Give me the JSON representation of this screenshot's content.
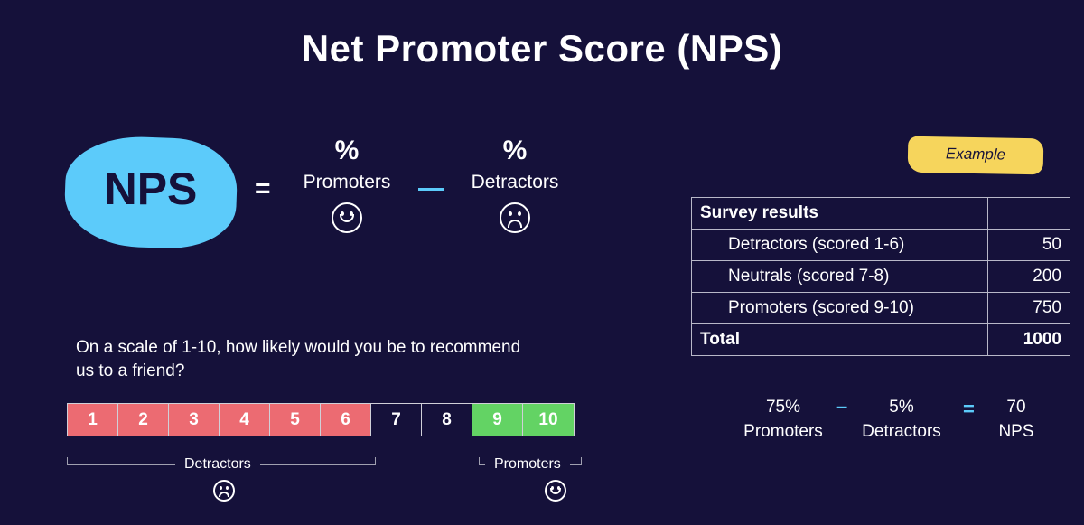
{
  "title": "Net Promoter Score (NPS)",
  "formula": {
    "lhs": "NPS",
    "equals": "=",
    "promoters": {
      "pct": "%",
      "label": "Promoters",
      "icon": "smiley-face-icon"
    },
    "minus": "−",
    "detractors": {
      "pct": "%",
      "label": "Detractors",
      "icon": "sad-face-icon"
    }
  },
  "example_badge": "Example",
  "survey_table": {
    "header": "Survey results",
    "rows": [
      {
        "label": "Detractors (scored 1-6)",
        "value": "50"
      },
      {
        "label": "Neutrals (scored 7-8)",
        "value": "200"
      },
      {
        "label": "Promoters (scored 9-10)",
        "value": "750"
      }
    ],
    "total_label": "Total",
    "total_value": "1000"
  },
  "calculation": {
    "promoters_pct": "75%",
    "promoters_label": "Promoters",
    "minus": "–",
    "detractors_pct": "5%",
    "detractors_label": "Detractors",
    "equals": "=",
    "result": "70",
    "result_label": "NPS"
  },
  "question": "On a scale of 1-10, how likely would you be to recommend us to a friend?",
  "scale": {
    "cells": [
      {
        "n": "1",
        "group": "detractor"
      },
      {
        "n": "2",
        "group": "detractor"
      },
      {
        "n": "3",
        "group": "detractor"
      },
      {
        "n": "4",
        "group": "detractor"
      },
      {
        "n": "5",
        "group": "detractor"
      },
      {
        "n": "6",
        "group": "detractor"
      },
      {
        "n": "7",
        "group": "neutral"
      },
      {
        "n": "8",
        "group": "neutral"
      },
      {
        "n": "9",
        "group": "promoter"
      },
      {
        "n": "10",
        "group": "promoter"
      }
    ],
    "detractors_label": "Detractors",
    "promoters_label": "Promoters"
  },
  "colors": {
    "background": "#15113a",
    "accent_blue": "#5ccbfa",
    "badge_yellow": "#f6d55c",
    "detractor_red": "#ec6b72",
    "promoter_green": "#63d364"
  }
}
